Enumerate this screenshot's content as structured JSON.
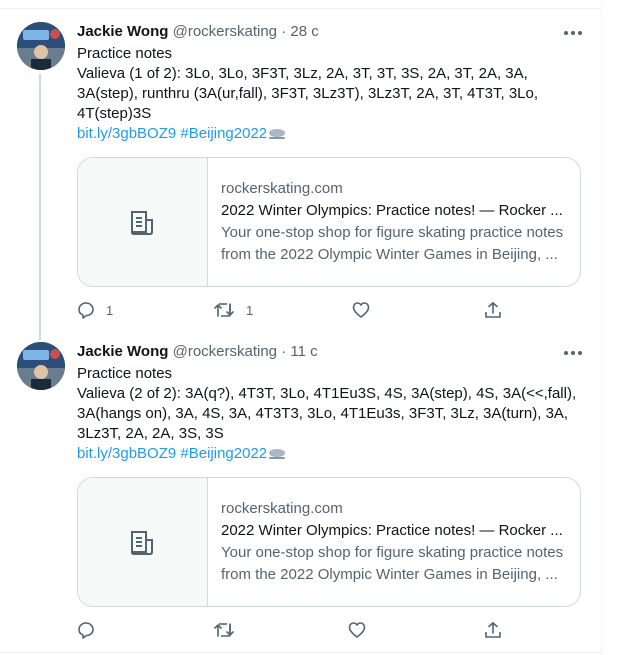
{
  "tweets": [
    {
      "author_name": "Jackie Wong",
      "handle": "@rockerskating",
      "separator": "·",
      "time": "28 с",
      "text_lines": [
        "Practice notes",
        "Valieva (1 of 2): 3Lo, 3Lo, 3F3T, 3Lz, 2A, 3T, 3T, 3S, 2A, 3T, 2A, 3A,",
        "3A(step), runthru (3A(ur,fall), 3F3T, 3Lz3T), 3Lz3T, 2A, 3T, 4T3T, 3Lo,",
        "4T(step)3S"
      ],
      "link_url": "bit.ly/3gbBOZ9",
      "hashtag": "#Beijing2022",
      "card": {
        "domain": "rockerskating.com",
        "title": "2022 Winter Olympics: Practice notes! — Rocker ...",
        "desc_line1": "Your one-stop shop for figure skating practice notes",
        "desc_line2": "from the 2022 Olympic Winter Games in Beijing, ..."
      },
      "actions": {
        "reply": "1",
        "retweet": "1",
        "like": "",
        "share": ""
      }
    },
    {
      "author_name": "Jackie Wong",
      "handle": "@rockerskating",
      "separator": "·",
      "time": "11 с",
      "text_lines": [
        "Practice notes",
        "Valieva (2 of 2): 3A(q?), 4T3T, 3Lo, 4T1Eu3S, 4S, 3A(step), 4S, 3A(<<,fall),",
        "3A(hangs on), 3A, 4S, 3A, 4T3T3, 3Lo, 4T1Eu3s, 3F3T, 3Lz, 3A(turn), 3A,",
        "3Lz3T, 2A, 2A, 3S, 3S"
      ],
      "link_url": "bit.ly/3gbBOZ9",
      "hashtag": "#Beijing2022",
      "card": {
        "domain": "rockerskating.com",
        "title": "2022 Winter Olympics: Practice notes! — Rocker ...",
        "desc_line1": "Your one-stop shop for figure skating practice notes",
        "desc_line2": "from the 2022 Olympic Winter Games in Beijing, ..."
      },
      "actions": {
        "reply": "",
        "retweet": "",
        "like": "",
        "share": ""
      }
    }
  ],
  "icons": {
    "more": "more-horizontal-icon",
    "article": "article-icon",
    "reply": "reply-icon",
    "retweet": "retweet-icon",
    "like": "heart-icon",
    "share": "share-icon",
    "emoji": "ice-skate-emoji-icon"
  },
  "colors": {
    "link": "#1d9bf0",
    "secondary_text": "#536471",
    "border": "#cfd9de"
  }
}
